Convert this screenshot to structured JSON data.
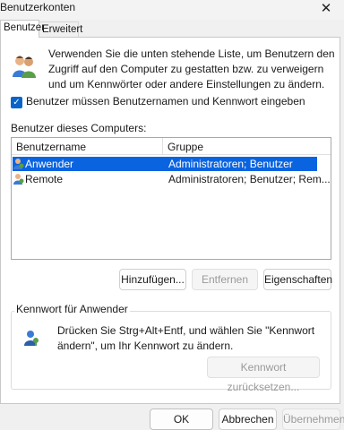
{
  "window": {
    "title": "Benutzerkonten",
    "close_glyph": "✕"
  },
  "tabs": [
    {
      "label": "Benutzer",
      "active": true
    },
    {
      "label": "Erweitert",
      "active": false
    }
  ],
  "intro": {
    "icon": "users-icon",
    "text": "Verwenden Sie die unten stehende Liste, um Benutzern den Zugriff auf den Computer zu gestatten bzw. zu verweigern und um Kennwörter oder andere Einstellungen zu ändern."
  },
  "require_login": {
    "checked": true,
    "label": "Benutzer müssen Benutzernamen und Kennwort eingeben"
  },
  "users_list": {
    "label": "Benutzer dieses Computers:",
    "columns": [
      "Benutzername",
      "Gruppe"
    ],
    "rows": [
      {
        "name": "Anwender",
        "group": "Administratoren; Benutzer",
        "selected": true
      },
      {
        "name": "Remote",
        "group": "Administratoren; Benutzer; Rem...",
        "selected": false
      }
    ]
  },
  "list_buttons": {
    "add": "Hinzufügen...",
    "remove": "Entfernen",
    "properties": "Eigenschaften"
  },
  "password_group": {
    "title": "Kennwort für Anwender",
    "text": "Drücken Sie Strg+Alt+Entf, und wählen Sie \"Kennwort ändern\", um Ihr Kennwort zu ändern.",
    "reset_button": "Kennwort zurücksetzen..."
  },
  "footer": {
    "ok": "OK",
    "cancel": "Abbrechen",
    "apply": "Übernehmen"
  },
  "colors": {
    "accent": "#0a64e0",
    "checkbox": "#0a64c8"
  }
}
